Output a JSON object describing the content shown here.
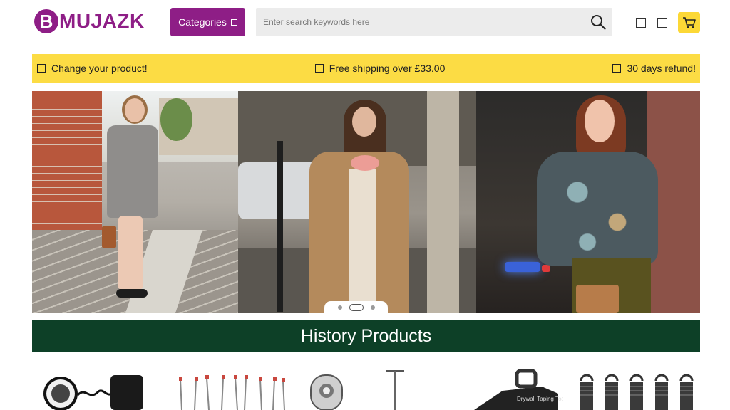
{
  "header": {
    "logo_letter": "B",
    "logo_text": "MUJAZK",
    "categories_label": "Categories",
    "search_placeholder": "Enter search keywords here",
    "icons": [
      "search-icon",
      "square-icon",
      "square-icon",
      "cart-icon"
    ]
  },
  "info_bar": {
    "items": [
      "Change your product!",
      "Free shipping over £33.00",
      "30 days refund!"
    ]
  },
  "banner": {
    "slides": 3,
    "active_slide": 1
  },
  "history": {
    "title": "History Products"
  },
  "products": [
    {
      "icon": "ring-light-icon"
    },
    {
      "icon": "pins-icon"
    },
    {
      "icon": "ratchet-icon"
    },
    {
      "icon": "t-pin-icon"
    },
    {
      "icon": "taping-tool-icon"
    },
    {
      "icon": "springs-icon"
    }
  ],
  "colors": {
    "brand": "#8e1e86",
    "info_bar": "#fcdc44",
    "history_bar": "#0d4027",
    "cart": "#fcd836"
  }
}
